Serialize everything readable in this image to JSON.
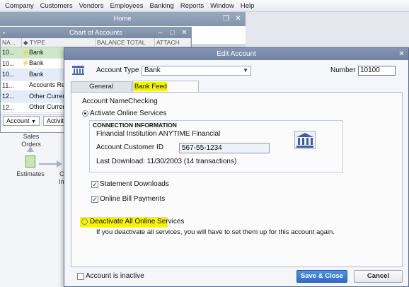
{
  "menu": [
    "Company",
    "Customers",
    "Vendors",
    "Employees",
    "Banking",
    "Reports",
    "Window",
    "Help"
  ],
  "home": {
    "title": "Home",
    "workflow": {
      "sales_orders": "Sales\nOrders",
      "estimates": "Estimates",
      "partial_c": "C",
      "partial_in": "In"
    }
  },
  "coa": {
    "title": "Chart of Accounts",
    "columns": [
      "NA...",
      "TYPE",
      "BALANCE TOTAL",
      "ATTACH"
    ],
    "rows": [
      {
        "name": "10...",
        "type": "Bank",
        "online": true
      },
      {
        "name": "10...",
        "type": "Bank",
        "online": true
      },
      {
        "name": "10...",
        "type": "Bank",
        "online": false
      },
      {
        "name": "11...",
        "type": "Accounts Re",
        "online": false
      },
      {
        "name": "12...",
        "type": "Other Curren",
        "online": false
      },
      {
        "name": "12...",
        "type": "Other Curren",
        "online": false
      }
    ],
    "footer": {
      "account_btn": "Account",
      "activities_btn": "Activitie"
    }
  },
  "dialog": {
    "title": "Edit Account",
    "account_type_label": "Account Type",
    "account_type_value": "Bank",
    "number_label": "Number",
    "number_value": "10100",
    "tabs": {
      "general": "General",
      "bank_feed": "Bank Feed Settings"
    },
    "account_name_label": "Account Name",
    "account_name_value": "Checking",
    "activate_label": "Activate Online Services",
    "connection_header": "CONNECTION INFORMATION",
    "fi_label": "Financial Institution",
    "fi_value": "ANYTIME Financial",
    "cust_id_label": "Account Customer ID",
    "cust_id_value": "567-55-1234",
    "last_download": "Last Download: 11/30/2003 (14 transactions)",
    "statement_downloads": "Statement Downloads",
    "online_bill_payments": "Online Bill Payments",
    "deactivate_label": "Deactivate All Online Services",
    "deactivate_note": "If you deactivate all services, you will have to set them up for this account again.",
    "inactive_label": "Account is inactive",
    "save_btn": "Save & Close",
    "cancel_btn": "Cancel"
  },
  "colors": {
    "highlight": "#f5f500",
    "primary_button": "#2f6dc4",
    "title_bar": "#7a8ba5"
  }
}
